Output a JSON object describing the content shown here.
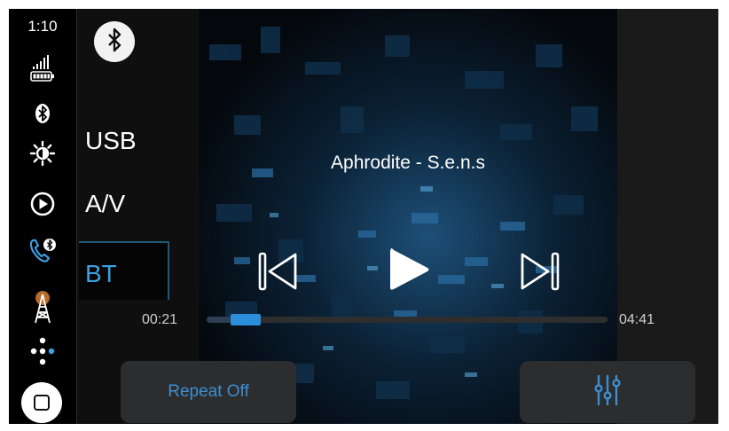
{
  "status": {
    "time": "1:10",
    "icons": [
      "signal-icon",
      "battery-icon",
      "bluetooth-icon",
      "brightness-icon",
      "play-circle-icon",
      "bluetooth-phone-icon",
      "radio-tower-icon",
      "apps-dots-icon"
    ]
  },
  "sources": {
    "bluetooth_icon": "bluetooth-icon",
    "items": [
      {
        "label": "USB"
      },
      {
        "label": "A/V"
      },
      {
        "label": "BT"
      }
    ],
    "active": "BT"
  },
  "player": {
    "track_title": "Aphrodite - S.e.n.s",
    "elapsed": "00:21",
    "duration": "04:41",
    "progress": 0.075,
    "repeat_label": "Repeat Off",
    "equalizer_icon": "equalizer-icon"
  },
  "colors": {
    "accent": "#2a8ed8",
    "background": "#141414",
    "button_bg": "#2c2d2f"
  }
}
